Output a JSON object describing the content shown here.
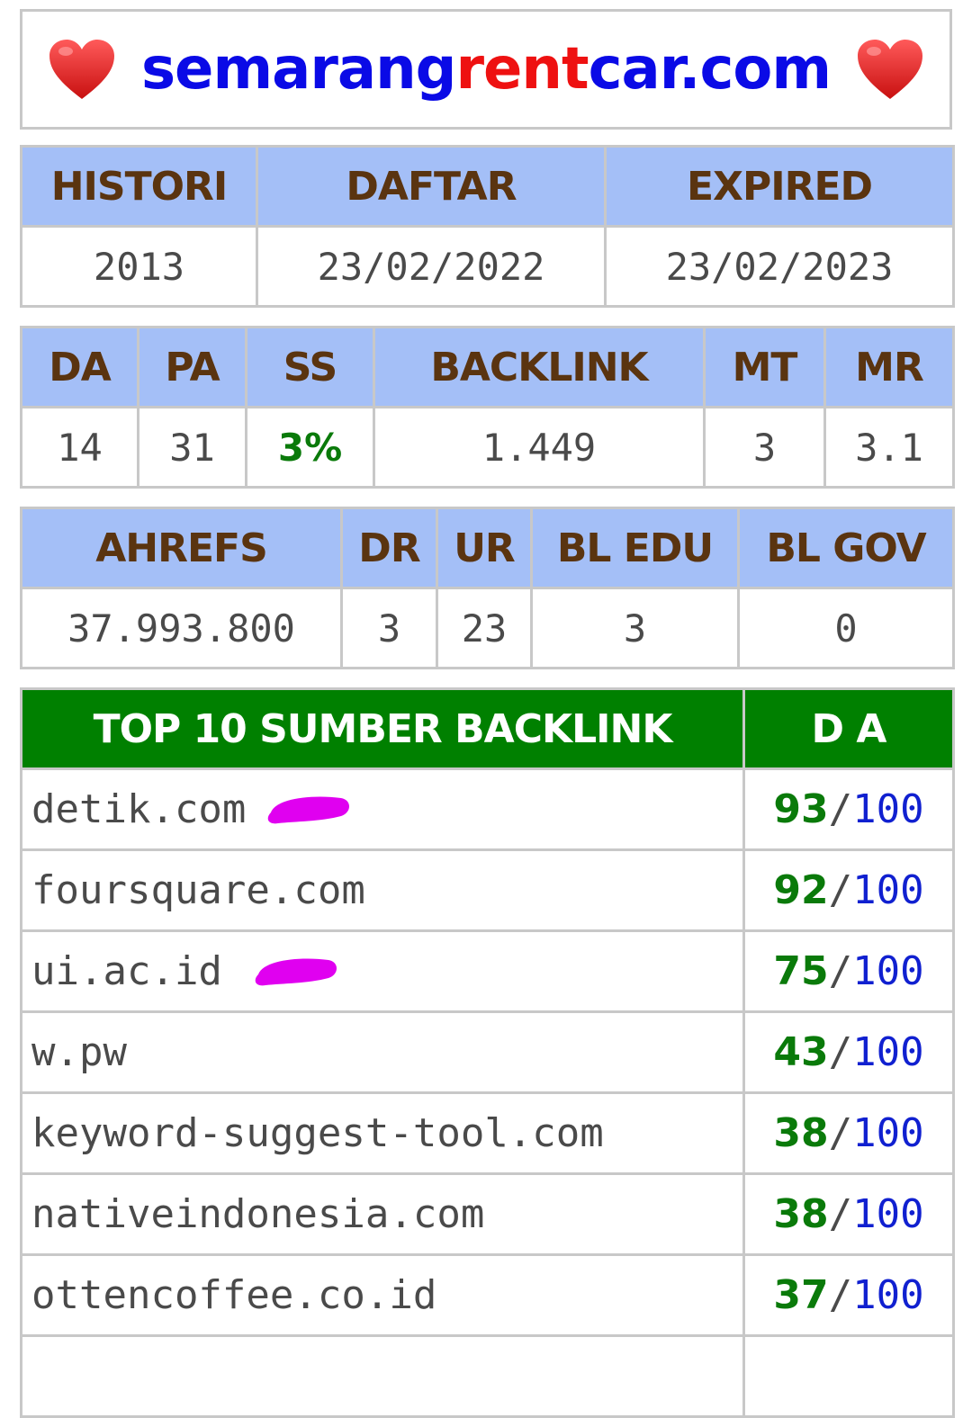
{
  "header": {
    "title_parts": [
      {
        "text": "semarang",
        "color": "#0a0ae6"
      },
      {
        "text": "rent",
        "color": "#ee1111"
      },
      {
        "text": "car.com",
        "color": "#0a0ae6"
      }
    ],
    "left_icon": "heart-icon",
    "right_icon": "heart-icon"
  },
  "domain_info": {
    "headers": [
      "HISTORI",
      "DAFTAR",
      "EXPIRED"
    ],
    "values": [
      "2013",
      "23/02/2022",
      "23/02/2023"
    ]
  },
  "moz_metrics": {
    "headers": [
      "DA",
      "PA",
      "SS",
      "BACKLINK",
      "MT",
      "MR"
    ],
    "values": [
      "14",
      "31",
      "3%",
      "1.449",
      "3",
      "3.1"
    ]
  },
  "ahrefs_metrics": {
    "headers": [
      "AHREFS",
      "DR",
      "UR",
      "BL EDU",
      "BL GOV"
    ],
    "values": [
      "37.993.800",
      "3",
      "23",
      "3",
      "0"
    ]
  },
  "backlinks": {
    "header_source": "TOP 10 SUMBER BACKLINK",
    "header_da": "D A",
    "separator": "/",
    "max": "100",
    "rows": [
      {
        "domain": "detik.com",
        "da": "93",
        "highlighted": true
      },
      {
        "domain": "foursquare.com",
        "da": "92",
        "highlighted": false
      },
      {
        "domain": "ui.ac.id",
        "da": "75",
        "highlighted": true
      },
      {
        "domain": "w.pw",
        "da": "43",
        "highlighted": false
      },
      {
        "domain": "keyword-suggest-tool.com",
        "da": "38",
        "highlighted": false
      },
      {
        "domain": "nativeindonesia.com",
        "da": "38",
        "highlighted": false
      },
      {
        "domain": "ottencoffee.co.id",
        "da": "37",
        "highlighted": false
      },
      {
        "domain": "",
        "da": "",
        "highlighted": false
      }
    ]
  },
  "colors": {
    "header_bg": "#a4bff7",
    "header_text": "#5a3410",
    "backlink_header_bg": "#008000",
    "da_value": "#0a7a0a",
    "da_max": "#1020d0",
    "highlight_mark": "#e000f0"
  }
}
